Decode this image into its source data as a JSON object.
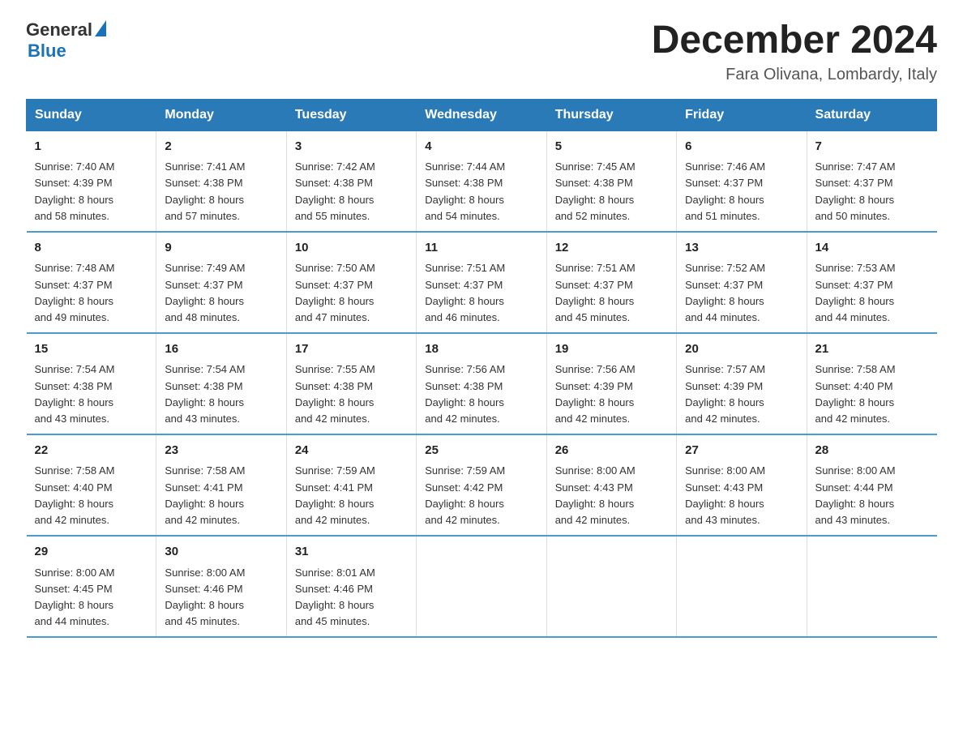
{
  "header": {
    "logo_general": "General",
    "logo_blue": "Blue",
    "month_title": "December 2024",
    "location": "Fara Olivana, Lombardy, Italy"
  },
  "weekdays": [
    "Sunday",
    "Monday",
    "Tuesday",
    "Wednesday",
    "Thursday",
    "Friday",
    "Saturday"
  ],
  "weeks": [
    [
      {
        "day": "1",
        "sunrise": "7:40 AM",
        "sunset": "4:39 PM",
        "daylight": "8 hours and 58 minutes."
      },
      {
        "day": "2",
        "sunrise": "7:41 AM",
        "sunset": "4:38 PM",
        "daylight": "8 hours and 57 minutes."
      },
      {
        "day": "3",
        "sunrise": "7:42 AM",
        "sunset": "4:38 PM",
        "daylight": "8 hours and 55 minutes."
      },
      {
        "day": "4",
        "sunrise": "7:44 AM",
        "sunset": "4:38 PM",
        "daylight": "8 hours and 54 minutes."
      },
      {
        "day": "5",
        "sunrise": "7:45 AM",
        "sunset": "4:38 PM",
        "daylight": "8 hours and 52 minutes."
      },
      {
        "day": "6",
        "sunrise": "7:46 AM",
        "sunset": "4:37 PM",
        "daylight": "8 hours and 51 minutes."
      },
      {
        "day": "7",
        "sunrise": "7:47 AM",
        "sunset": "4:37 PM",
        "daylight": "8 hours and 50 minutes."
      }
    ],
    [
      {
        "day": "8",
        "sunrise": "7:48 AM",
        "sunset": "4:37 PM",
        "daylight": "8 hours and 49 minutes."
      },
      {
        "day": "9",
        "sunrise": "7:49 AM",
        "sunset": "4:37 PM",
        "daylight": "8 hours and 48 minutes."
      },
      {
        "day": "10",
        "sunrise": "7:50 AM",
        "sunset": "4:37 PM",
        "daylight": "8 hours and 47 minutes."
      },
      {
        "day": "11",
        "sunrise": "7:51 AM",
        "sunset": "4:37 PM",
        "daylight": "8 hours and 46 minutes."
      },
      {
        "day": "12",
        "sunrise": "7:51 AM",
        "sunset": "4:37 PM",
        "daylight": "8 hours and 45 minutes."
      },
      {
        "day": "13",
        "sunrise": "7:52 AM",
        "sunset": "4:37 PM",
        "daylight": "8 hours and 44 minutes."
      },
      {
        "day": "14",
        "sunrise": "7:53 AM",
        "sunset": "4:37 PM",
        "daylight": "8 hours and 44 minutes."
      }
    ],
    [
      {
        "day": "15",
        "sunrise": "7:54 AM",
        "sunset": "4:38 PM",
        "daylight": "8 hours and 43 minutes."
      },
      {
        "day": "16",
        "sunrise": "7:54 AM",
        "sunset": "4:38 PM",
        "daylight": "8 hours and 43 minutes."
      },
      {
        "day": "17",
        "sunrise": "7:55 AM",
        "sunset": "4:38 PM",
        "daylight": "8 hours and 42 minutes."
      },
      {
        "day": "18",
        "sunrise": "7:56 AM",
        "sunset": "4:38 PM",
        "daylight": "8 hours and 42 minutes."
      },
      {
        "day": "19",
        "sunrise": "7:56 AM",
        "sunset": "4:39 PM",
        "daylight": "8 hours and 42 minutes."
      },
      {
        "day": "20",
        "sunrise": "7:57 AM",
        "sunset": "4:39 PM",
        "daylight": "8 hours and 42 minutes."
      },
      {
        "day": "21",
        "sunrise": "7:58 AM",
        "sunset": "4:40 PM",
        "daylight": "8 hours and 42 minutes."
      }
    ],
    [
      {
        "day": "22",
        "sunrise": "7:58 AM",
        "sunset": "4:40 PM",
        "daylight": "8 hours and 42 minutes."
      },
      {
        "day": "23",
        "sunrise": "7:58 AM",
        "sunset": "4:41 PM",
        "daylight": "8 hours and 42 minutes."
      },
      {
        "day": "24",
        "sunrise": "7:59 AM",
        "sunset": "4:41 PM",
        "daylight": "8 hours and 42 minutes."
      },
      {
        "day": "25",
        "sunrise": "7:59 AM",
        "sunset": "4:42 PM",
        "daylight": "8 hours and 42 minutes."
      },
      {
        "day": "26",
        "sunrise": "8:00 AM",
        "sunset": "4:43 PM",
        "daylight": "8 hours and 42 minutes."
      },
      {
        "day": "27",
        "sunrise": "8:00 AM",
        "sunset": "4:43 PM",
        "daylight": "8 hours and 43 minutes."
      },
      {
        "day": "28",
        "sunrise": "8:00 AM",
        "sunset": "4:44 PM",
        "daylight": "8 hours and 43 minutes."
      }
    ],
    [
      {
        "day": "29",
        "sunrise": "8:00 AM",
        "sunset": "4:45 PM",
        "daylight": "8 hours and 44 minutes."
      },
      {
        "day": "30",
        "sunrise": "8:00 AM",
        "sunset": "4:46 PM",
        "daylight": "8 hours and 45 minutes."
      },
      {
        "day": "31",
        "sunrise": "8:01 AM",
        "sunset": "4:46 PM",
        "daylight": "8 hours and 45 minutes."
      },
      null,
      null,
      null,
      null
    ]
  ],
  "labels": {
    "sunrise": "Sunrise:",
    "sunset": "Sunset:",
    "daylight": "Daylight:"
  }
}
